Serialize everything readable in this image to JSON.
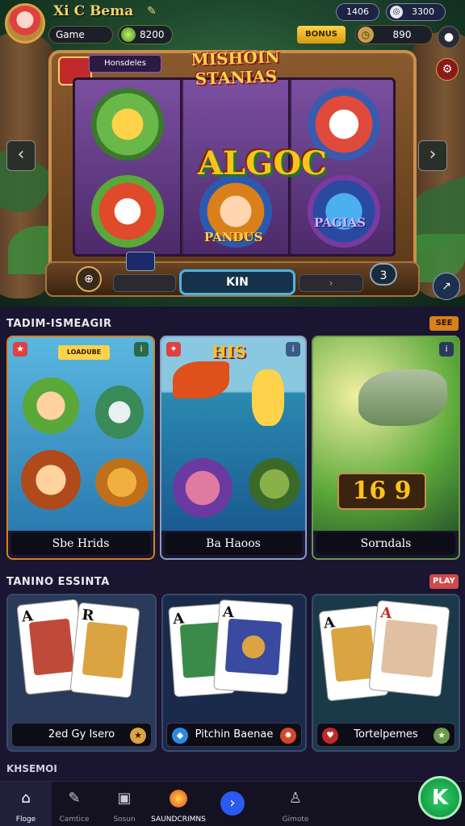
{
  "player": {
    "name": "Xi C Bema",
    "level_label": "Game",
    "gems": "8200",
    "coins_top": "3300",
    "top_badge": "1406",
    "timer_value": "890",
    "bonus_label": "BONUS"
  },
  "hero": {
    "machine_title_line1": "MISHOIN",
    "machine_title_line2": "STANIAS",
    "center_label": "ALGOC",
    "tag_label": "Honsdeles",
    "symbol_label_mid": "PANDUS",
    "symbol_label_right": "PAGIAS",
    "spin_label": "KIN",
    "side_badge": "3"
  },
  "sections": [
    {
      "title": "TADIM-ISMEAGIR",
      "tag": "SEE",
      "cards": [
        {
          "name": "Sbe Hrids",
          "banner": "LOADUBE"
        },
        {
          "name": "Ba Haoos",
          "banner": "HIS"
        },
        {
          "name": "Sorndals",
          "banner": "16 9"
        }
      ]
    },
    {
      "title": "TANINO ESSINTA",
      "tag": "PLAY",
      "cards": [
        {
          "name": "2ed Gy Isero",
          "rank_a": "A",
          "rank_b": "R"
        },
        {
          "name": "Pitchin Baenae",
          "rank_a": "A",
          "rank_b": "A"
        },
        {
          "name": "Tortelpemes",
          "rank_a": "A",
          "rank_b": "A"
        }
      ]
    }
  ],
  "bottom_section_title": "KHSEMOI",
  "nav": [
    {
      "label": "Floge",
      "icon": "home-icon"
    },
    {
      "label": "Camtice",
      "icon": "controller-icon"
    },
    {
      "label": "Sosun",
      "icon": "tile-icon"
    },
    {
      "label": "SAUNDCRIMNS",
      "icon": "flame-icon"
    },
    {
      "label": "",
      "icon": "arrow-right-icon"
    },
    {
      "label": "Gimote",
      "icon": "profile-icon"
    }
  ],
  "fab_label": "K",
  "colors": {
    "gold": "#ffd24a",
    "panel": "#0d0d18",
    "accent_green": "#2ed06a",
    "accent_blue": "#2a5aee"
  }
}
